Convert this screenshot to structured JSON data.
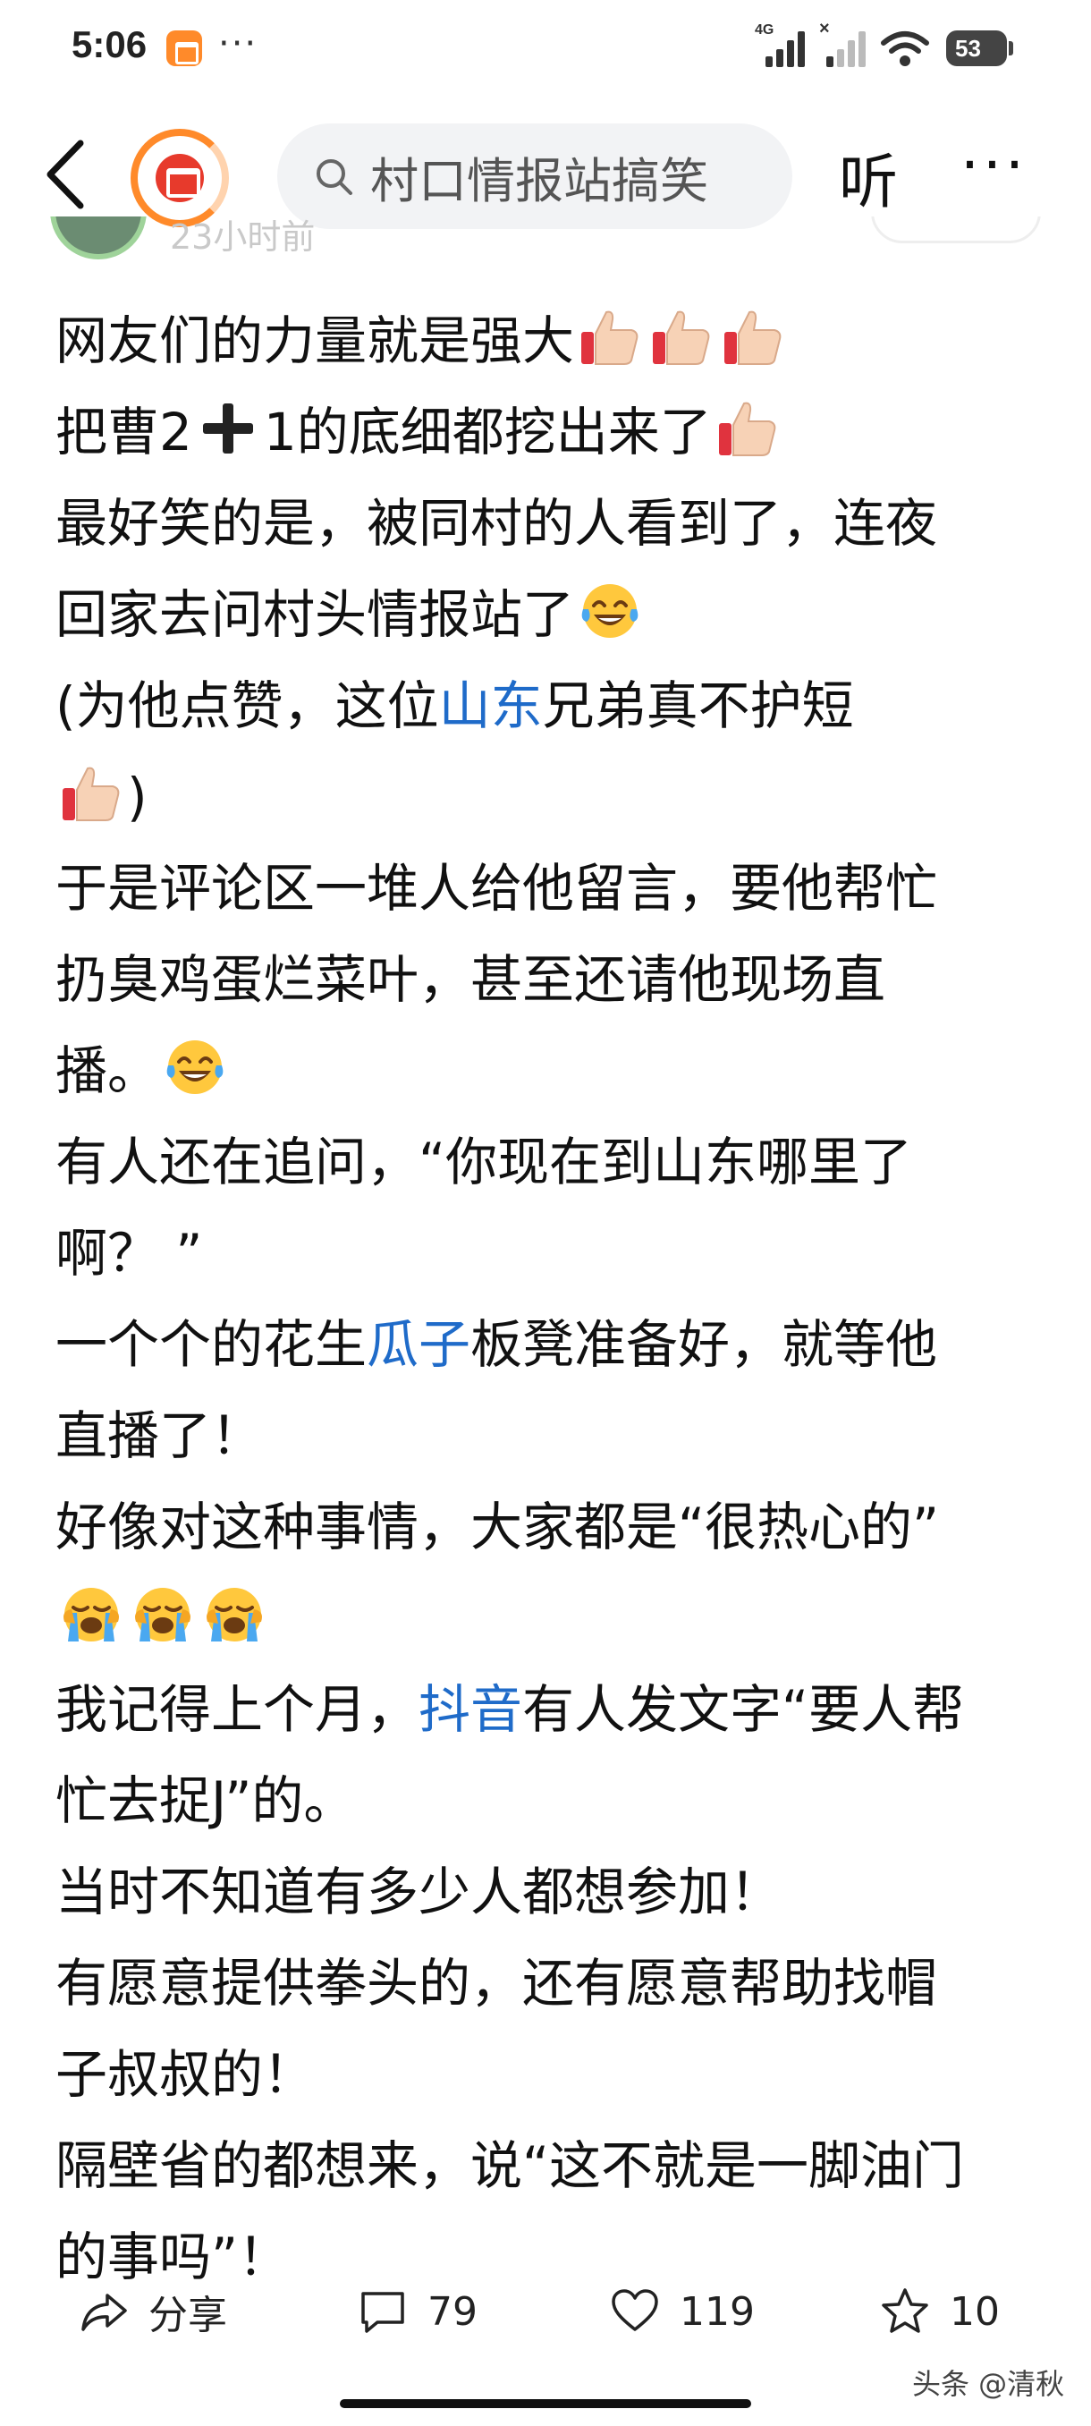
{
  "status_bar": {
    "time": "5:06",
    "more": "···",
    "network_label": "4G",
    "sim2_marker": "×",
    "battery": "53"
  },
  "header": {
    "search_placeholder": "村口情报站搞笑",
    "listen_label": "听",
    "more_label": "···"
  },
  "post_meta": {
    "time_partial": "23小时前"
  },
  "article": {
    "lines": [
      [
        "网友们的力量就是强大",
        {
          "emoji": "thumbs-up"
        },
        {
          "emoji": "thumbs-up"
        },
        {
          "emoji": "thumbs-up"
        }
      ],
      [
        "把曹2",
        {
          "emoji": "plus"
        },
        "1的底细都挖出来了",
        {
          "emoji": "thumbs-up"
        }
      ],
      [
        "最好笑的是，被同村的人看到了，连夜"
      ],
      [
        "回家去问村头情报站了",
        {
          "emoji": "tears-of-joy"
        }
      ],
      [
        "(为他点赞，这位",
        {
          "link": "山东"
        },
        "兄弟真不护短"
      ],
      [
        {
          "emoji": "thumbs-up"
        },
        ")"
      ],
      [
        "于是评论区一堆人给他留言，要他帮忙"
      ],
      [
        "扔臭鸡蛋烂菜叶，甚至还请他现场直"
      ],
      [
        "播。",
        {
          "emoji": "tears-of-joy"
        }
      ],
      [
        "有人还在追问，“你现在到山东哪里了"
      ],
      [
        "啊？ ”"
      ],
      [
        "一个个的花生",
        {
          "link": "瓜子"
        },
        "板凳准备好，就等他"
      ],
      [
        "直播了！"
      ],
      [
        "好像对这种事情，大家都是“很热心的”"
      ],
      [
        {
          "emoji": "loudly-crying"
        },
        {
          "emoji": "loudly-crying"
        },
        {
          "emoji": "loudly-crying"
        }
      ],
      [
        "我记得上个月，",
        {
          "link": "抖音"
        },
        "有人发文字“要人帮"
      ],
      [
        "忙去捉J”的。"
      ],
      [
        "当时不知道有多少人都想参加！"
      ],
      [
        "有愿意提供拳头的，还有愿意帮助找帽"
      ],
      [
        "子叔叔的！"
      ],
      [
        "隔壁省的都想来，说“这不就是一脚油门"
      ],
      [
        "的事吗”！"
      ]
    ]
  },
  "actions": {
    "share_label": "分享",
    "comment_count": "79",
    "like_count": "119",
    "favorite_count": "10"
  },
  "watermark": "头条 @清秋",
  "colors": {
    "link": "#1f6bc9",
    "brand_orange": "#ff8a2a",
    "brand_red": "#e73a2c"
  }
}
